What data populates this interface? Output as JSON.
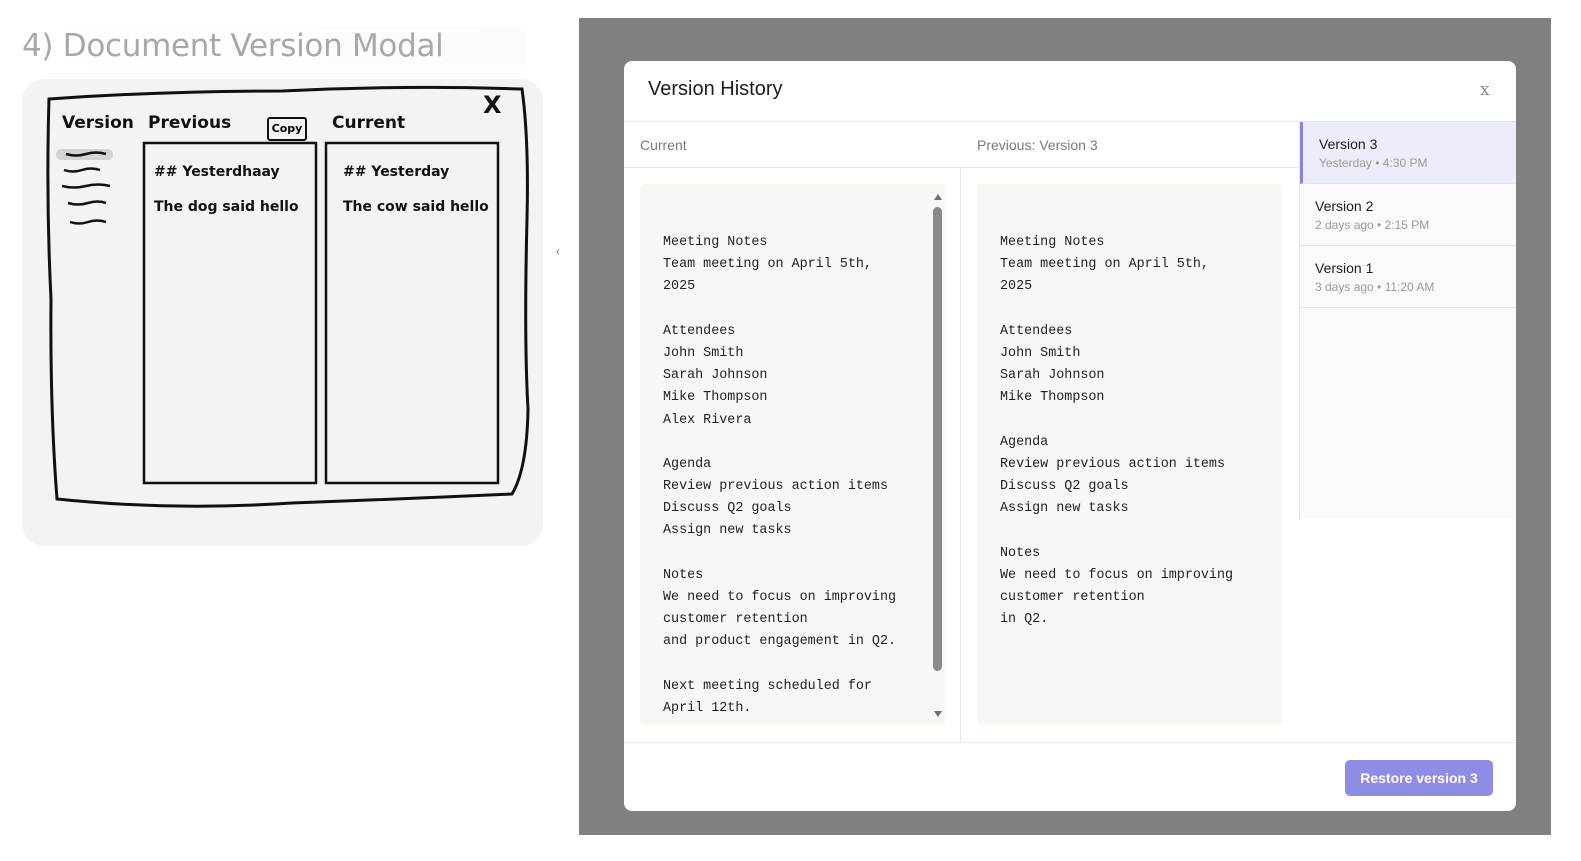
{
  "sketch": {
    "title": "4) Document Version Modal",
    "col_version": "Version",
    "col_previous": "Previous",
    "col_current": "Current",
    "copy_label": "Copy",
    "close_mark": "X",
    "prev_heading": "## Yesterdhaay",
    "prev_body": "The dog said hello",
    "curr_heading": "## Yesterday",
    "curr_body": "The cow said hello"
  },
  "collapse_arrow": "‹",
  "modal": {
    "title": "Version History",
    "close_label": "x",
    "current_header": "Current",
    "previous_header": "Previous: Version 3",
    "current_lines": [
      "Meeting Notes",
      "Team meeting on April 5th,",
      "2025",
      "",
      "Attendees",
      "John Smith",
      "Sarah Johnson",
      "Mike Thompson",
      "Alex Rivera",
      "",
      "Agenda",
      "Review previous action items",
      "Discuss Q2 goals",
      "Assign new tasks",
      "",
      "Notes",
      "We need to focus on improving",
      "customer retention",
      "and product engagement in Q2.",
      "",
      "Next meeting scheduled for",
      "April 12th."
    ],
    "previous_lines": [
      "Meeting Notes",
      "Team meeting on April 5th,",
      "2025",
      "",
      "Attendees",
      "John Smith",
      "Sarah Johnson",
      "Mike Thompson",
      "",
      "Agenda",
      "Review previous action items",
      "Discuss Q2 goals",
      "Assign new tasks",
      "",
      "Notes",
      "We need to focus on improving",
      "customer retention",
      "in Q2."
    ],
    "versions": [
      {
        "name": "Version 3",
        "meta": "Yesterday • 4:30 PM",
        "selected": true
      },
      {
        "name": "Version 2",
        "meta": "2 days ago • 2:15 PM",
        "selected": false
      },
      {
        "name": "Version 1",
        "meta": "3 days ago • 11:20 AM",
        "selected": false
      }
    ],
    "restore_label": "Restore version 3"
  },
  "colors": {
    "accent": "#8f8ce6",
    "selected_bg": "#ecedfb",
    "overlay": "#808080",
    "doc_bg": "#f8f7f3"
  }
}
